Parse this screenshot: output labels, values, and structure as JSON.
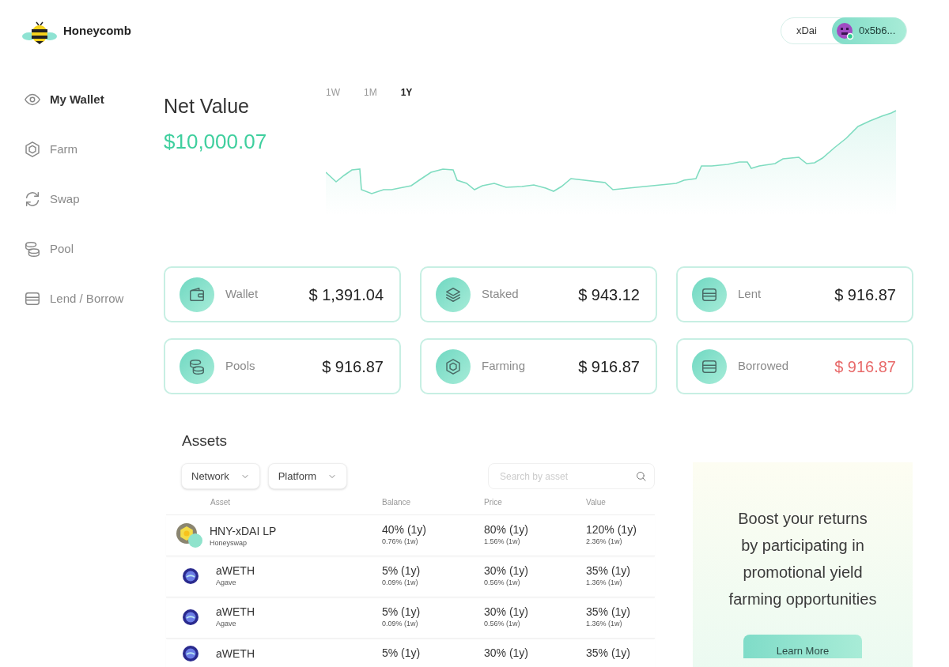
{
  "brand": {
    "name": "Honeycomb"
  },
  "account": {
    "network": "xDai",
    "address": "0x5b6..."
  },
  "sidebar": {
    "items": [
      {
        "label": "My Wallet",
        "kind": "eye",
        "selected": true
      },
      {
        "label": "Farm",
        "kind": "hexagon",
        "selected": false
      },
      {
        "label": "Swap",
        "kind": "swap",
        "selected": false
      },
      {
        "label": "Pool",
        "kind": "coins",
        "selected": false
      },
      {
        "label": "Lend / Borrow",
        "kind": "card",
        "selected": false
      }
    ]
  },
  "net_value": {
    "title": "Net Value",
    "amount": "$10,000.07"
  },
  "range_tabs": [
    {
      "label": "1W",
      "selected": false
    },
    {
      "label": "1M",
      "selected": false
    },
    {
      "label": "1Y",
      "selected": true
    }
  ],
  "summary_cards": [
    {
      "label": "Wallet",
      "value": "$ 1,391.04",
      "kind": "wallet",
      "negative": false
    },
    {
      "label": "Staked",
      "value": "$ 943.12",
      "kind": "layers",
      "negative": false
    },
    {
      "label": "Lent",
      "value": "$ 916.87",
      "kind": "card",
      "negative": false
    },
    {
      "label": "Pools",
      "value": "$ 916.87",
      "kind": "coins",
      "negative": false
    },
    {
      "label": "Farming",
      "value": "$ 916.87",
      "kind": "hexagon",
      "negative": false
    },
    {
      "label": "Borrowed",
      "value": "$ 916.87",
      "kind": "card",
      "negative": true
    }
  ],
  "assets": {
    "title": "Assets",
    "filters": [
      "Network",
      "Platform"
    ],
    "search": {
      "placeholder": "Search by asset"
    },
    "columns": [
      "Asset",
      "Balance",
      "Price",
      "Value"
    ],
    "rows": [
      {
        "kind": "lp",
        "name": "HNY-xDAI LP",
        "platform": "Honeyswap",
        "balance": "40% (1y)",
        "balance_week": "0.76% (1w)",
        "price": "80% (1y)",
        "price_week": "1.56% (1w)",
        "value": "120% (1y)",
        "value_week": "2.36% (1w)"
      },
      {
        "kind": "token",
        "name": "aWETH",
        "platform": "Agave",
        "balance": "5% (1y)",
        "balance_week": "0.09% (1w)",
        "price": "30% (1y)",
        "price_week": "0.56% (1w)",
        "value": "35% (1y)",
        "value_week": "1.36% (1w)"
      },
      {
        "kind": "token",
        "name": "aWETH",
        "platform": "Agave",
        "balance": "5% (1y)",
        "balance_week": "0.09% (1w)",
        "price": "30% (1y)",
        "price_week": "0.56% (1w)",
        "value": "35% (1y)",
        "value_week": "1.36% (1w)"
      },
      {
        "kind": "token",
        "name": "aWETH",
        "balance": "5% (1y)",
        "price": "30% (1y)",
        "value": "35% (1y)"
      }
    ]
  },
  "promo": {
    "lines": [
      "Boost your returns",
      "by participating in",
      "promotional yield",
      "farming opportunities"
    ],
    "button": "Learn More"
  }
}
